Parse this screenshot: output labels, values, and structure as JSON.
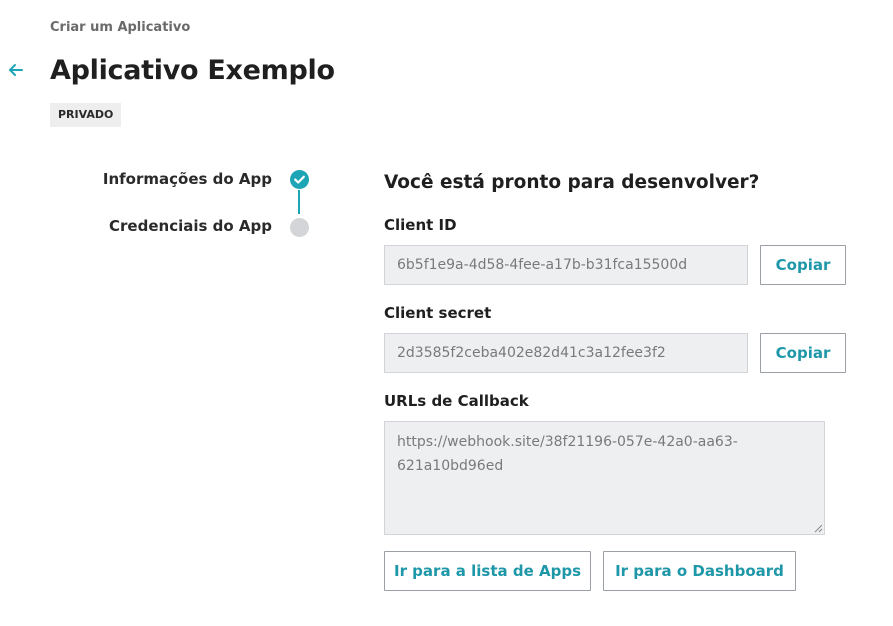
{
  "breadcrumb": "Criar um Aplicativo",
  "title": "Aplicativo Exemplo",
  "badge": "PRIVADO",
  "steps": [
    {
      "label": "Informações do App",
      "status": "complete"
    },
    {
      "label": "Credenciais do App",
      "status": "pending"
    }
  ],
  "heading": "Você está pronto para desenvolver?",
  "client_id": {
    "label": "Client ID",
    "value": "6b5f1e9a-4d58-4fee-a17b-b31fca15500d",
    "copy": "Copiar"
  },
  "client_secret": {
    "label": "Client secret",
    "value": "2d3585f2ceba402e82d41c3a12fee3f2",
    "copy": "Copiar"
  },
  "callback": {
    "label": "URLs de Callback",
    "value": "https://webhook.site/38f21196-057e-42a0-aa63-621a10bd96ed"
  },
  "actions": {
    "apps_list": "Ir para a lista de Apps",
    "dashboard": "Ir para o Dashboard"
  },
  "colors": {
    "accent": "#1ea5b5",
    "field_bg": "#eeeff0",
    "pending": "#d3d5d8"
  }
}
